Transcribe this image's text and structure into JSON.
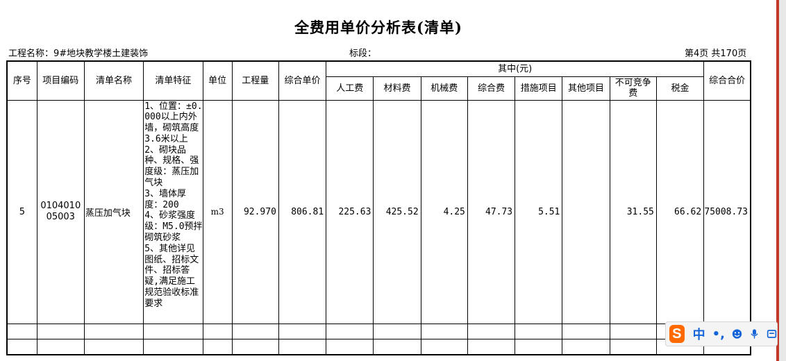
{
  "document": {
    "title": "全费用单价分析表(清单)",
    "project_label": "工程名称：9#地块教学楼土建装饰",
    "section_label": "标段：",
    "page_info": "第4页  共170页"
  },
  "table": {
    "headers": {
      "seq": "序号",
      "code": "项目编码",
      "name": "清单名称",
      "feature": "清单特征",
      "unit": "单位",
      "quantity": "工程量",
      "unit_price": "综合单价",
      "group": "其中(元)",
      "labor": "人工费",
      "material": "材料费",
      "machine": "机械费",
      "overhead": "综合费",
      "measures": "措施项目",
      "other": "其他项目",
      "noncompetitive": "不可竞争费",
      "tax": "税金",
      "total": "综合合价"
    },
    "row": {
      "seq": "5",
      "code": "010401005003",
      "name": "蒸压加气块",
      "feature": "1、位置：±0.000以上内外墙，砌筑高度3.6米以上\n2、砌块品种、规格、强度级：蒸压加气块\n3、墙体厚度：200\n4、砂浆强度级：M5.0预拌砌筑砂浆\n5、其他详见图纸、招标文件、招标答疑,满足施工规范验收标准要求",
      "unit": "m3",
      "quantity": "92.970",
      "unit_price": "806.81",
      "labor": "225.63",
      "material": "425.52",
      "machine": "4.25",
      "overhead": "47.73",
      "measures": "5.51",
      "other": "",
      "noncompetitive": "31.55",
      "tax": "66.62",
      "total": "75008.73"
    }
  },
  "ime_toolbar": {
    "logo": "S",
    "mode": "中",
    "punct": "•,",
    "colors": {
      "logo": "#ff6a00",
      "icons": "#1565d8"
    }
  }
}
